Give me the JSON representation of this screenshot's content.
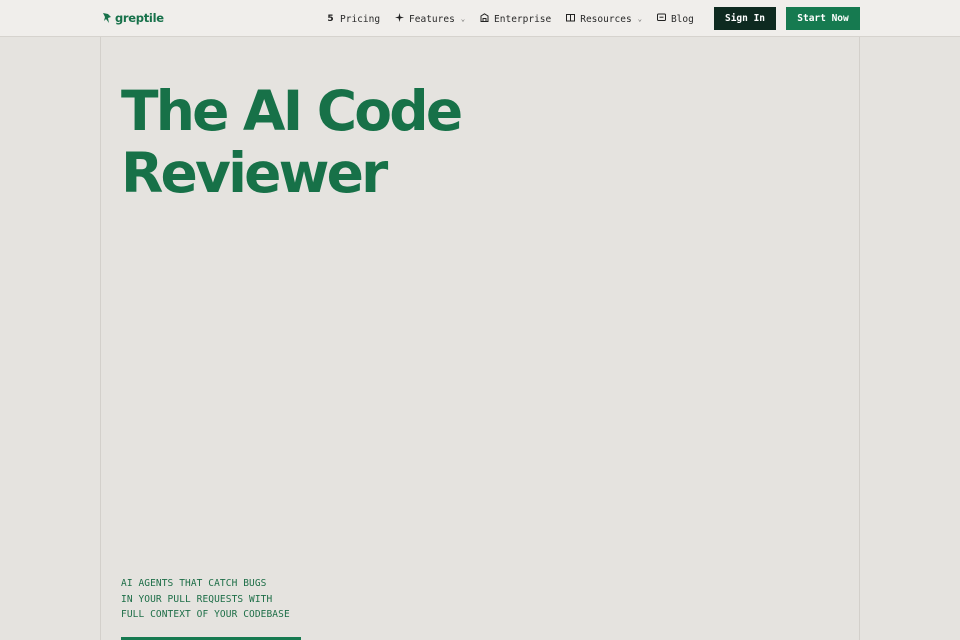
{
  "header": {
    "logo_text": "greptile",
    "nav": [
      {
        "label": "Pricing",
        "icon": "5"
      },
      {
        "label": "Features",
        "icon": "sparkle-icon",
        "has_dropdown": true
      },
      {
        "label": "Enterprise",
        "icon": "building-icon"
      },
      {
        "label": "Resources",
        "icon": "book-icon",
        "has_dropdown": true
      },
      {
        "label": "Blog",
        "icon": "message-icon"
      }
    ],
    "sign_in_label": "Sign In",
    "start_label": "Start Now"
  },
  "hero": {
    "title_line1": "The AI Code",
    "title_line2": "Reviewer",
    "tagline_lines": [
      "AI AGENTS THAT CATCH BUGS",
      "IN YOUR PULL REQUESTS WITH",
      "FULL CONTEXT OF YOUR CODEBASE"
    ]
  },
  "colors": {
    "brand_green": "#177148",
    "button_dark": "#0e2a20",
    "button_green": "#167a50",
    "background": "#e5e3df"
  }
}
